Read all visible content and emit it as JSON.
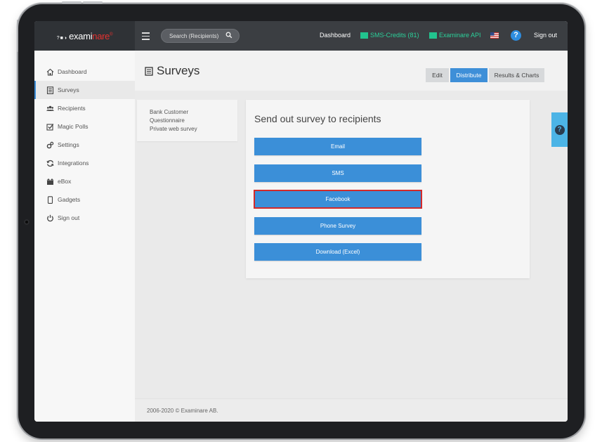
{
  "topbar": {
    "logo_prefix": "?■◑",
    "logo_text_a": "exami",
    "logo_text_b": "nare",
    "logo_mark": "®",
    "search_placeholder": "Search (Recipients)",
    "dashboard": "Dashboard",
    "sms_credits": "SMS-Credits (81)",
    "api": "Examinare API",
    "help": "?",
    "signout": "Sign out"
  },
  "sidebar": {
    "items": [
      {
        "label": "Dashboard",
        "icon": "home-icon"
      },
      {
        "label": "Surveys",
        "icon": "survey-icon"
      },
      {
        "label": "Recipients",
        "icon": "users-icon"
      },
      {
        "label": "Magic Polls",
        "icon": "checkbox-icon"
      },
      {
        "label": "Settings",
        "icon": "gear-icon"
      },
      {
        "label": "Integrations",
        "icon": "sync-icon"
      },
      {
        "label": "eBox",
        "icon": "inbox-icon"
      },
      {
        "label": "Gadgets",
        "icon": "device-icon"
      },
      {
        "label": "Sign out",
        "icon": "power-icon"
      }
    ],
    "active": "Surveys"
  },
  "page": {
    "title": "Surveys",
    "tabs": {
      "edit": "Edit",
      "distribute": "Distribute",
      "results": "Results & Charts"
    }
  },
  "survey_list": [
    "Bank Customer",
    "Questionnaire",
    "Private web survey"
  ],
  "distribute": {
    "title": "Send out survey to recipients",
    "buttons": [
      "Email",
      "SMS",
      "Facebook",
      "Phone Survey",
      "Download (Excel)"
    ],
    "selected": "Facebook"
  },
  "help_tab": "?",
  "footer": "2006-2020 © Examinare AB.",
  "colors": {
    "accent": "#3b8fd8",
    "topbar": "#3b3e42",
    "credit_green": "#2bd09a",
    "selection_red": "#d32a2a"
  }
}
